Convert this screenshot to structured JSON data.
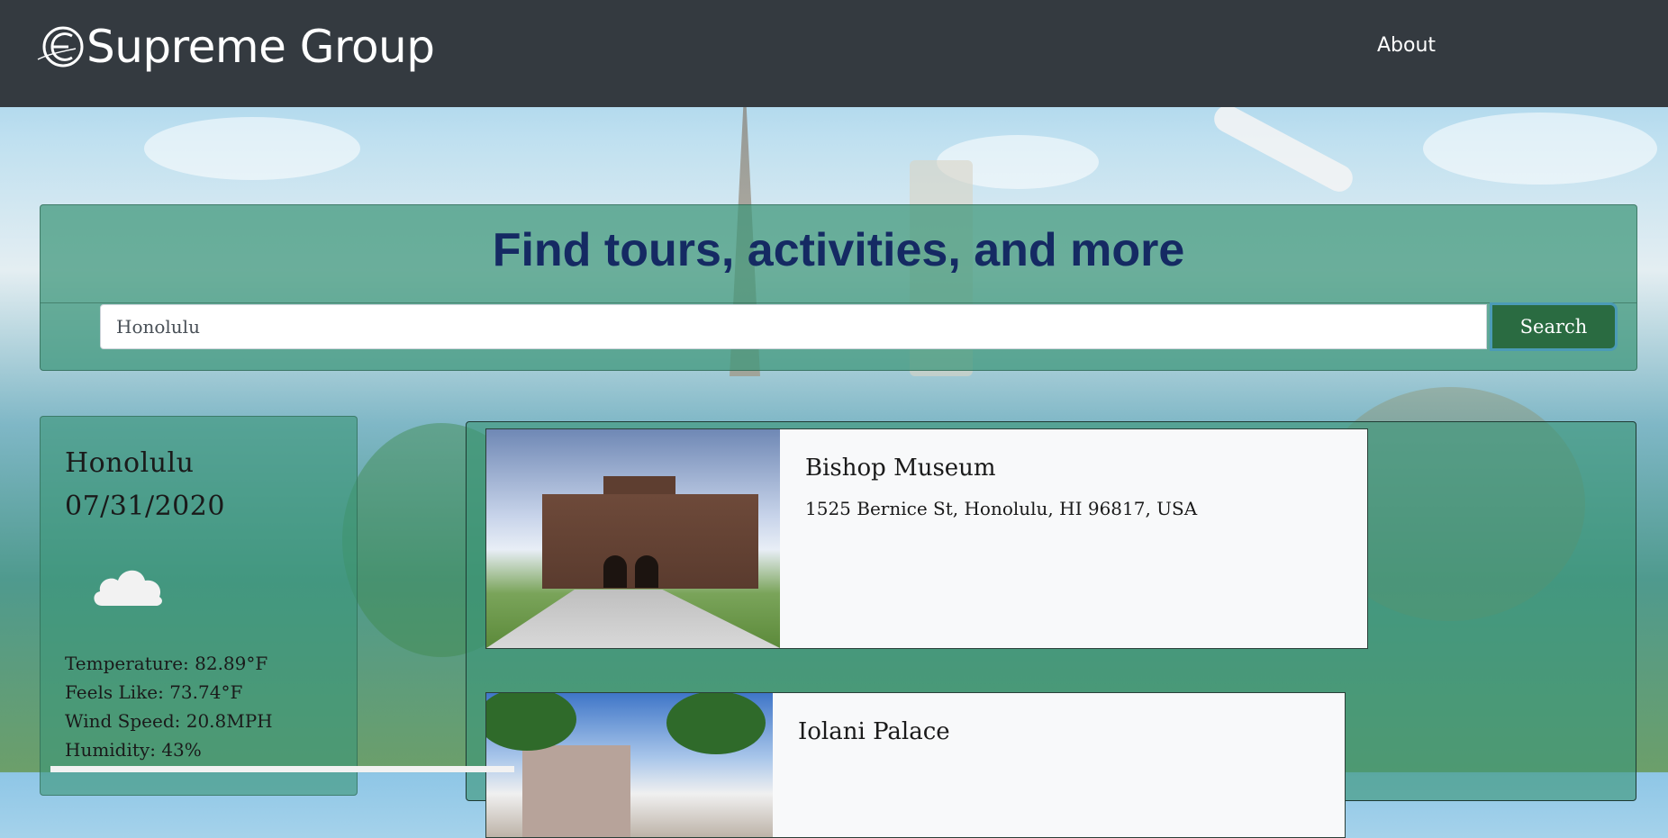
{
  "navbar": {
    "brand": "Supreme Group",
    "links": [
      {
        "label": "About"
      }
    ]
  },
  "hero": {
    "title": "Find tours, activities, and more",
    "search": {
      "value": "Honolulu",
      "placeholder": "",
      "button_label": "Search"
    }
  },
  "weather": {
    "city": "Honolulu",
    "date": "07/31/2020",
    "icon": "cloud-icon",
    "temperature": "Temperature: 82.89°F",
    "feels_like": "Feels Like: 73.74°F",
    "wind_speed": "Wind Speed: 20.8MPH",
    "humidity": "Humidity: 43%"
  },
  "results": [
    {
      "name": "Bishop Museum",
      "address": "1525 Bernice St, Honolulu, HI 96817, USA"
    },
    {
      "name": "Iolani Palace",
      "address": ""
    }
  ],
  "colors": {
    "navbar_bg": "#343a40",
    "panel_bg": "#3c9678",
    "title": "#152a63",
    "search_button": "#2a6b41"
  }
}
